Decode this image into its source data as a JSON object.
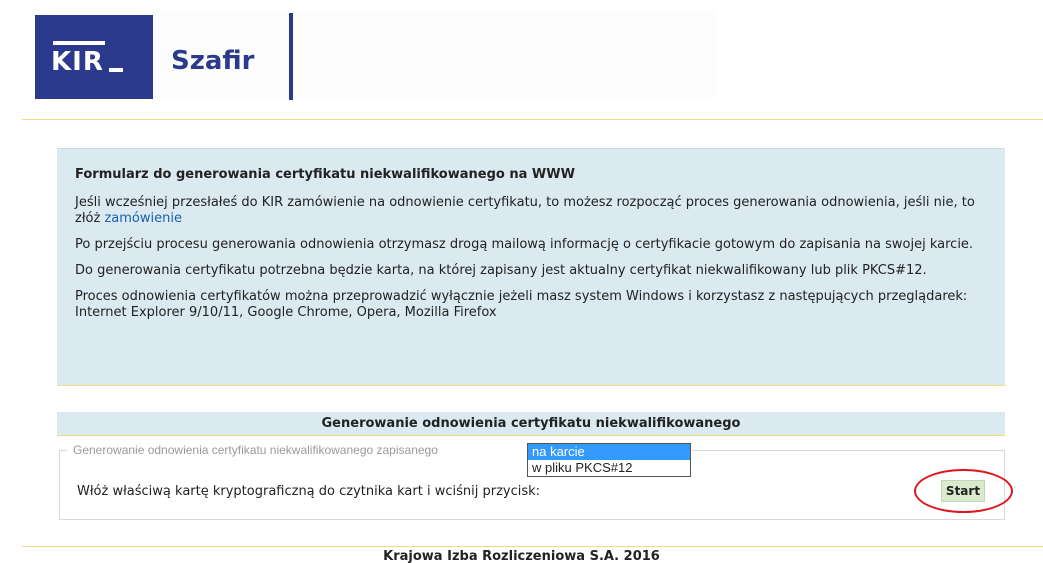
{
  "header": {
    "logo_kir": "KIR",
    "logo_szafir": "Szafir",
    "brand_color": "#2b3a8c"
  },
  "info": {
    "title": "Formularz do generowania certyfikatu niekwalifikowanego na WWW",
    "p1_text": "Jeśli wcześniej przesłałeś do KIR zamówienie na odnowienie certyfikatu, to możesz rozpocząć proces generowania odnowienia, jeśli nie, to złóż ",
    "p1_link": "zamówienie",
    "p2": "Po przejściu procesu generowania odnowienia otrzymasz drogą mailową informację o certyfikacie gotowym do zapisania na swojej karcie.",
    "p3": "Do generowania certyfikatu potrzebna będzie karta, na której zapisany jest aktualny certyfikat niekwalifikowany lub plik PKCS#12.",
    "p4": "Proces odnowienia certyfikatów można przeprowadzić wyłącznie jeżeli masz system Windows i korzystasz z następujących przeglądarek: Internet Explorer 9/10/11, Google Chrome, Opera, Mozilla Firefox"
  },
  "section": {
    "title": "Generowanie odnowienia certyfikatu niekwalifikowanego",
    "legend": "Generowanie odnowienia certyfikatu niekwalifikowanego zapisanego",
    "options": [
      "na karcie",
      "w pliku PKCS#12"
    ],
    "selected": "na karcie",
    "instruction": "Włóż właściwą kartę kryptograficzną do czytnika kart i wciśnij przycisk:",
    "start_label": "Start",
    "highlight_color": "#e0141b"
  },
  "footer": {
    "text": "Krajowa Izba Rozliczeniowa S.A. 2016"
  }
}
